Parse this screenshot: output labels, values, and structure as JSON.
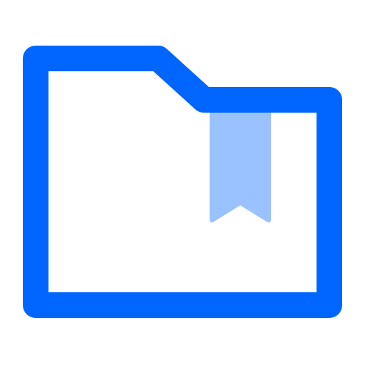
{
  "icon": {
    "name": "folder-bookmark-icon",
    "stroke_color": "#0066FF",
    "fill_color": "#FFFFFF",
    "bookmark_color": "#99C2FF"
  }
}
